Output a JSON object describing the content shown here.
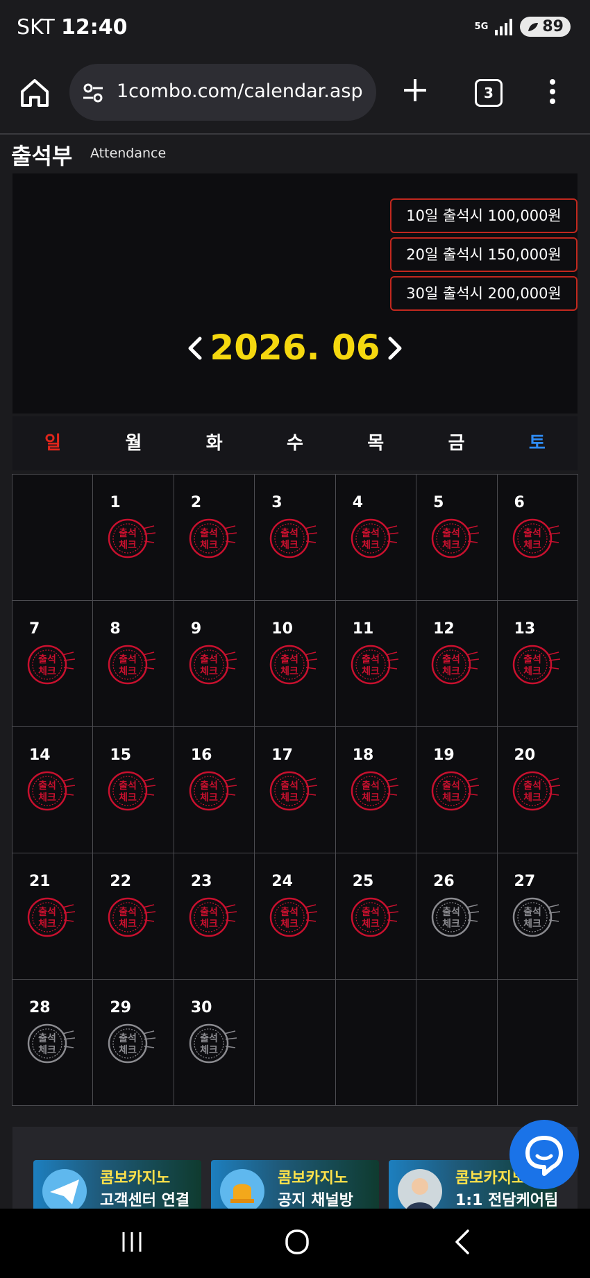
{
  "status_bar": {
    "carrier": "SKT",
    "time": "12:40",
    "network": "5G",
    "battery": "89"
  },
  "browser": {
    "url": "1combo.com/calendar.asp",
    "tab_count": "3"
  },
  "attendance": {
    "title": "출석부",
    "subtitle": "Attendance"
  },
  "rewards": [
    "10일 출석시 100,000원",
    "20일 출석시 150,000원",
    "30일 출석시 200,000원"
  ],
  "month": {
    "label": "2026. 06"
  },
  "weekdays": [
    "일",
    "월",
    "화",
    "수",
    "목",
    "금",
    "토"
  ],
  "calendar": {
    "checked_color": "#c8102e",
    "unchecked_color": "#8a8a8f",
    "stamp_text": [
      "출석",
      "체크"
    ],
    "weeks": [
      [
        null,
        {
          "day": "1",
          "checked": true
        },
        {
          "day": "2",
          "checked": true
        },
        {
          "day": "3",
          "checked": true
        },
        {
          "day": "4",
          "checked": true
        },
        {
          "day": "5",
          "checked": true
        },
        {
          "day": "6",
          "checked": true
        }
      ],
      [
        {
          "day": "7",
          "checked": true
        },
        {
          "day": "8",
          "checked": true
        },
        {
          "day": "9",
          "checked": true
        },
        {
          "day": "10",
          "checked": true
        },
        {
          "day": "11",
          "checked": true
        },
        {
          "day": "12",
          "checked": true
        },
        {
          "day": "13",
          "checked": true
        }
      ],
      [
        {
          "day": "14",
          "checked": true
        },
        {
          "day": "15",
          "checked": true
        },
        {
          "day": "16",
          "checked": true
        },
        {
          "day": "17",
          "checked": true
        },
        {
          "day": "18",
          "checked": true
        },
        {
          "day": "19",
          "checked": true
        },
        {
          "day": "20",
          "checked": true
        }
      ],
      [
        {
          "day": "21",
          "checked": true
        },
        {
          "day": "22",
          "checked": true
        },
        {
          "day": "23",
          "checked": true
        },
        {
          "day": "24",
          "checked": true
        },
        {
          "day": "25",
          "checked": true
        },
        {
          "day": "26",
          "checked": false
        },
        {
          "day": "27",
          "checked": false
        }
      ],
      [
        {
          "day": "28",
          "checked": false
        },
        {
          "day": "29",
          "checked": false
        },
        {
          "day": "30",
          "checked": false
        },
        null,
        null,
        null,
        null
      ]
    ]
  },
  "banners": [
    {
      "line1": "콤보카지노",
      "line2": "고객센터 연결",
      "icon": "paper-plane-icon"
    },
    {
      "line1": "콤보카지노",
      "line2": "공지 채널방",
      "icon": "bell-icon"
    },
    {
      "line1": "콤보카지노",
      "line2": "1:1 전담케어팀",
      "icon": "agent-avatar-icon"
    }
  ],
  "accent_colors": {
    "month": "#f5d80f",
    "sunday": "#e0261c",
    "saturday": "#2f8cf5",
    "reward_border": "#c2281e",
    "chat": "#1a73e8"
  }
}
